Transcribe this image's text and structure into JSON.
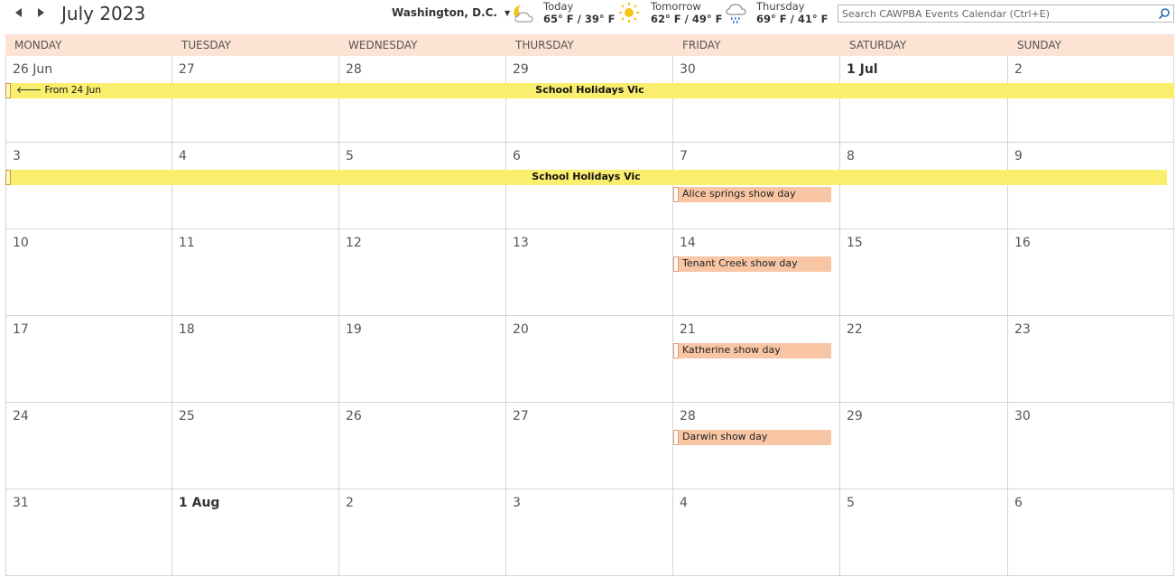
{
  "header": {
    "month_title": "July 2023",
    "location": "Washington, D.C.",
    "weather": [
      {
        "label": "Today",
        "temp": "65° F / 39° F",
        "icon": "partly-cloudy-night-icon"
      },
      {
        "label": "Tomorrow",
        "temp": "62° F / 49° F",
        "icon": "sun-icon"
      },
      {
        "label": "Thursday",
        "temp": "69° F / 41° F",
        "icon": "rain-cloud-icon"
      }
    ],
    "search_placeholder": "Search CAWPBA Events Calendar (Ctrl+E)"
  },
  "days_of_week": [
    "MONDAY",
    "TUESDAY",
    "WEDNESDAY",
    "THURSDAY",
    "FRIDAY",
    "SATURDAY",
    "SUNDAY"
  ],
  "weeks": [
    [
      "26 Jun",
      "27",
      "28",
      "29",
      "30",
      "1 Jul",
      "2"
    ],
    [
      "3",
      "4",
      "5",
      "6",
      "7",
      "8",
      "9"
    ],
    [
      "10",
      "11",
      "12",
      "13",
      "14",
      "15",
      "16"
    ],
    [
      "17",
      "18",
      "19",
      "20",
      "21",
      "22",
      "23"
    ],
    [
      "24",
      "25",
      "26",
      "27",
      "28",
      "29",
      "30"
    ],
    [
      "31",
      "1 Aug",
      "2",
      "3",
      "4",
      "5",
      "6"
    ]
  ],
  "events": {
    "school_holidays_week1": {
      "title": "School Holidays Vic",
      "from_label": "From 24 Jun"
    },
    "school_holidays_week2": {
      "title": "School Holidays Vic"
    },
    "alice_springs": {
      "title": "Alice springs show day"
    },
    "tenant_creek": {
      "title": "Tenant Creek show day"
    },
    "katherine": {
      "title": "Katherine show day"
    },
    "darwin": {
      "title": "Darwin show day"
    }
  },
  "colors": {
    "header_bg": "#fde3d3",
    "holiday": "#f9ee6e",
    "show_day": "#f8c6a5"
  }
}
